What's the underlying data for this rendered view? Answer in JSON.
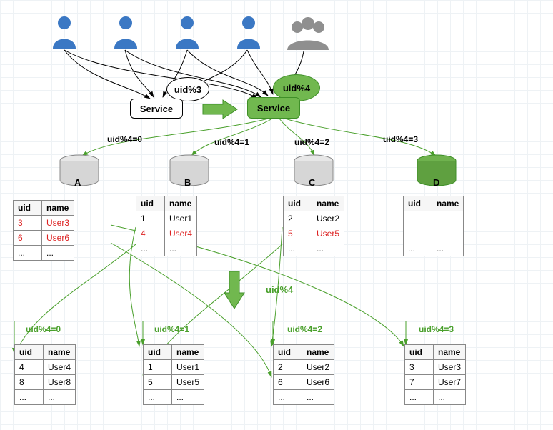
{
  "bubbles": {
    "old": "uid%3",
    "new": "uid%4"
  },
  "service": {
    "old": "Service",
    "new": "Service"
  },
  "routes_top": {
    "a": "uid%4=0",
    "b": "uid%4=1",
    "c": "uid%4=2",
    "d": "uid%4=3"
  },
  "middle_label": "uid%4",
  "routes_bottom": {
    "a": "uid%4=0",
    "b": "uid%4=1",
    "c": "uid%4=2",
    "d": "uid%4=3"
  },
  "db_labels": {
    "a": "A",
    "b": "B",
    "c": "C",
    "d": "D"
  },
  "columns": {
    "uid": "uid",
    "name": "name"
  },
  "ellipsis": "...",
  "table_old_a": {
    "rows": [
      {
        "uid": "3",
        "name": "User3",
        "red": true
      },
      {
        "uid": "6",
        "name": "User6",
        "red": true
      }
    ]
  },
  "table_old_b": {
    "rows": [
      {
        "uid": "1",
        "name": "User1",
        "red": false
      },
      {
        "uid": "4",
        "name": "User4",
        "red": true
      }
    ]
  },
  "table_old_c": {
    "rows": [
      {
        "uid": "2",
        "name": "User2",
        "red": false
      },
      {
        "uid": "5",
        "name": "User5",
        "red": true
      }
    ]
  },
  "table_old_d": {
    "rows": []
  },
  "table_new_a": {
    "rows": [
      {
        "uid": "4",
        "name": "User4"
      },
      {
        "uid": "8",
        "name": "User8"
      }
    ]
  },
  "table_new_b": {
    "rows": [
      {
        "uid": "1",
        "name": "User1"
      },
      {
        "uid": "5",
        "name": "User5"
      }
    ]
  },
  "table_new_c": {
    "rows": [
      {
        "uid": "2",
        "name": "User2"
      },
      {
        "uid": "6",
        "name": "User6"
      }
    ]
  },
  "table_new_d": {
    "rows": [
      {
        "uid": "3",
        "name": "User3"
      },
      {
        "uid": "7",
        "name": "User7"
      }
    ]
  }
}
